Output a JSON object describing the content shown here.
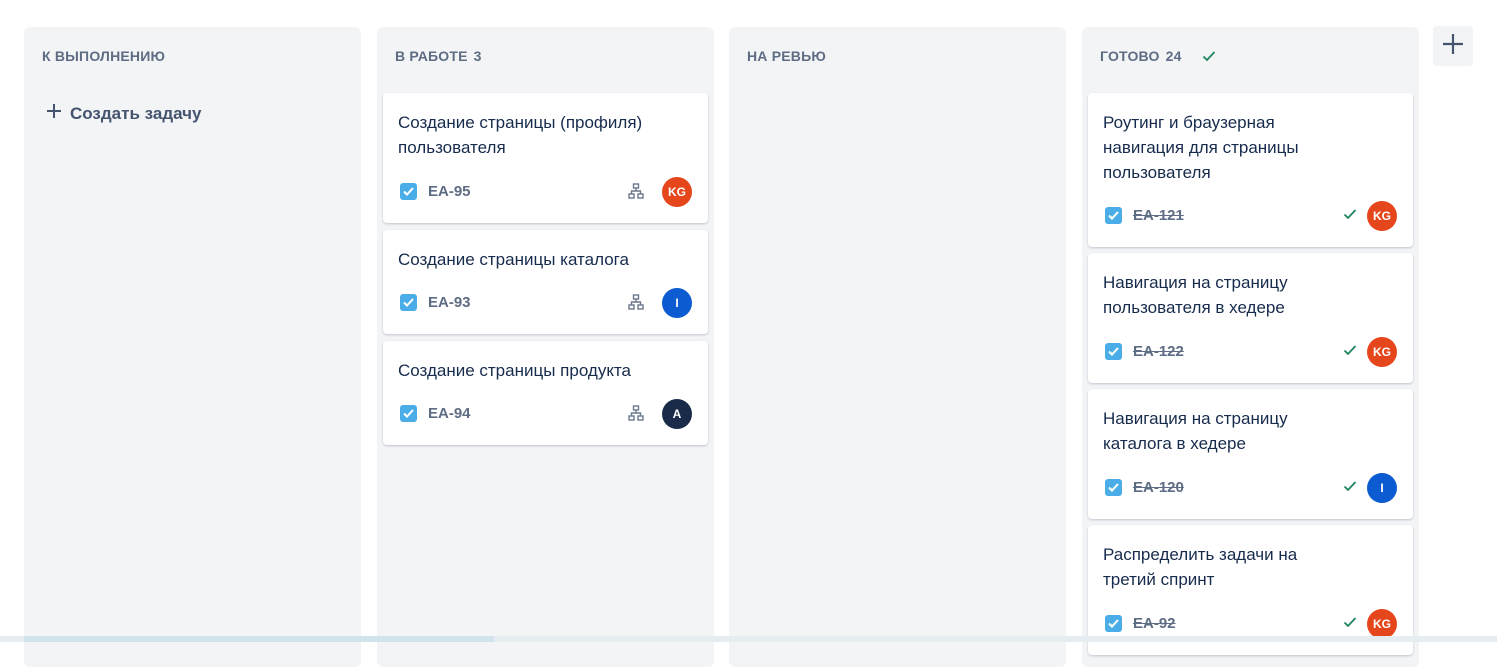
{
  "colors": {
    "column_bg": "#f3f4f6",
    "check_blue": "#4bade8",
    "done_green": "#1f845a",
    "avatar_kg": "#e5461b",
    "avatar_i": "#0c5bd1",
    "avatar_a": "#1a2b4a"
  },
  "columns": [
    {
      "title": "К ВЫПОЛНЕНИЮ",
      "count": "",
      "create_label": "Создать задачу"
    },
    {
      "title": "В РАБОТЕ",
      "count": "3",
      "cards": [
        {
          "title": "Создание страницы (профиля) пользователя",
          "key": "EA-95",
          "avatar": "KG"
        },
        {
          "title": "Создание страницы каталога",
          "key": "EA-93",
          "avatar": "I"
        },
        {
          "title": "Создание страницы продукта",
          "key": "EA-94",
          "avatar": "A"
        }
      ]
    },
    {
      "title": "НА РЕВЬЮ",
      "count": ""
    },
    {
      "title": "ГОТОВО",
      "count": "24",
      "cards": [
        {
          "title": "Роутинг и браузерная навигация для страницы пользователя",
          "key": "EA-121",
          "avatar": "KG"
        },
        {
          "title": "Навигация на страницу пользователя в хедере",
          "key": "EA-122",
          "avatar": "KG"
        },
        {
          "title": "Навигация на страницу каталога в хедере",
          "key": "EA-120",
          "avatar": "I"
        },
        {
          "title": "Распределить задачи на третий спринт",
          "key": "EA-92",
          "avatar": "KG"
        }
      ]
    }
  ],
  "icons": {
    "add_column": "plus-icon",
    "create": "plus-icon",
    "task_type": "checkbox-icon",
    "subtasks": "hierarchy-icon",
    "done": "check-icon"
  }
}
